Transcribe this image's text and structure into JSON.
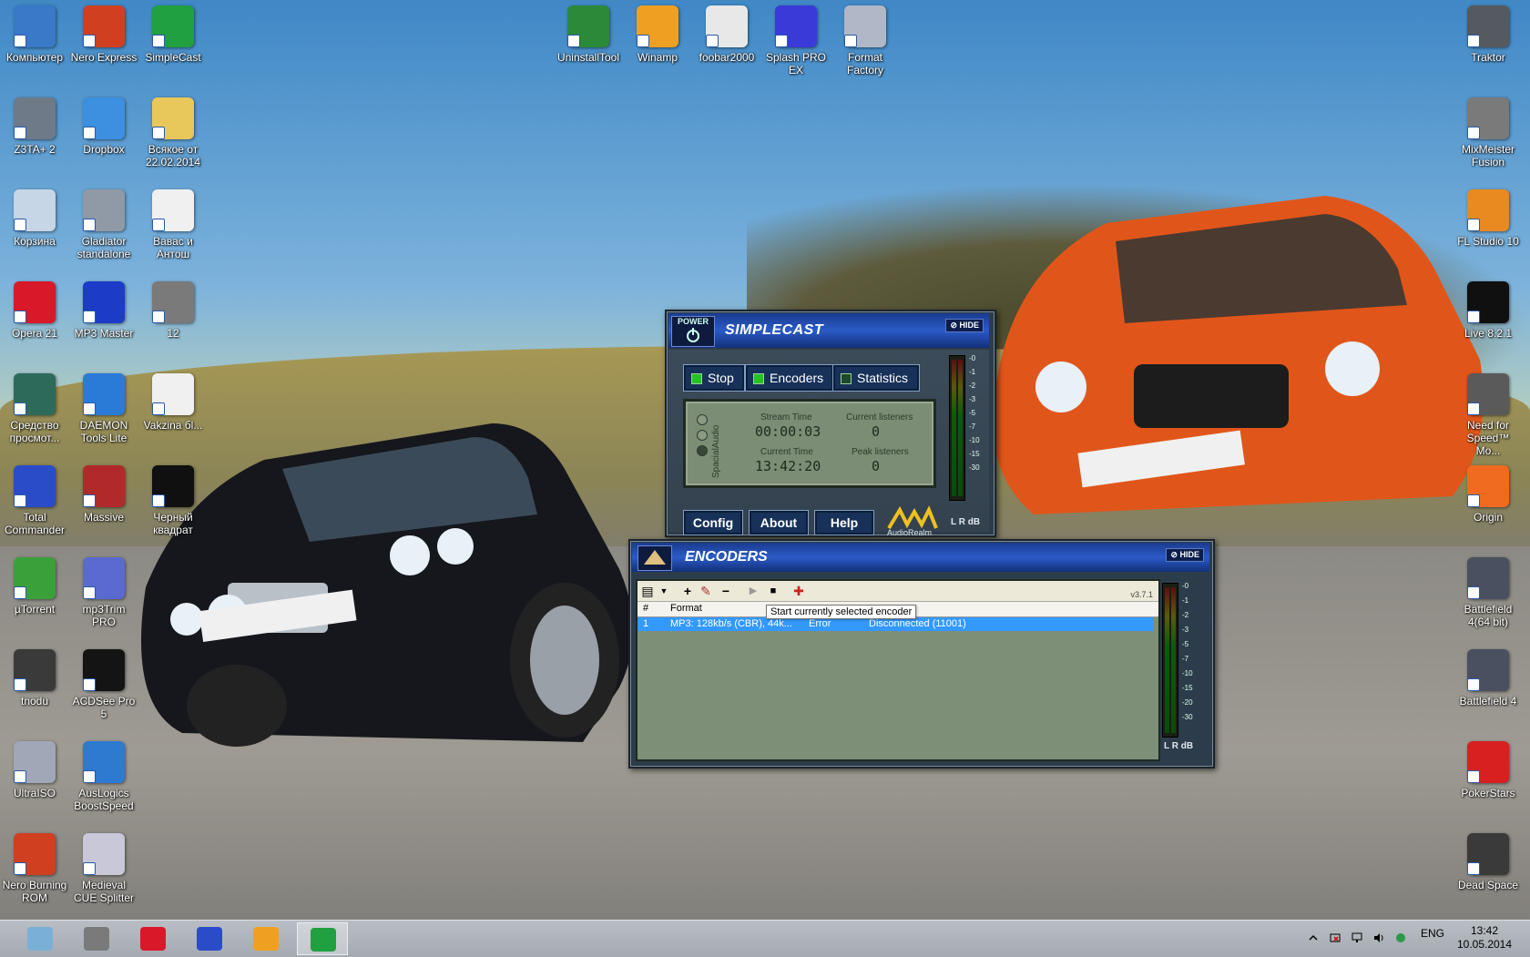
{
  "desktop": {
    "icons": [
      {
        "label": "Компьютер",
        "icon": "computer-icon",
        "color": "#3a78c8"
      },
      {
        "label": "Nero Express",
        "icon": "nero-flame-icon",
        "color": "#d04020"
      },
      {
        "label": "SimpleCast",
        "icon": "simplecast-icon",
        "color": "#20a040"
      },
      {
        "label": "Z3TA+ 2",
        "icon": "z3ta-icon",
        "color": "#6e7a88"
      },
      {
        "label": "Dropbox",
        "icon": "dropbox-icon",
        "color": "#3d8fe0"
      },
      {
        "label": "Всякое от 22.02.2014",
        "icon": "folder-icon",
        "color": "#e8c85a"
      },
      {
        "label": "Корзина",
        "icon": "recycle-bin-icon",
        "color": "#c6d6e6"
      },
      {
        "label": "Gladiator standalone",
        "icon": "gladiator-icon",
        "color": "#8f9aa6"
      },
      {
        "label": "Вавас и Антош",
        "icon": "document-icon",
        "color": "#f0f0f0"
      },
      {
        "label": "Opera 21",
        "icon": "opera-icon",
        "color": "#d8192a"
      },
      {
        "label": "MP3 Master",
        "icon": "mp3-master-icon",
        "color": "#1c3cc8"
      },
      {
        "label": "12",
        "icon": "mixmeister-icon",
        "color": "#7a7a7a"
      },
      {
        "label": "Средство просмот...",
        "icon": "viewer-icon",
        "color": "#2e6a5a"
      },
      {
        "label": "DAEMON Tools Lite",
        "icon": "daemon-tools-icon",
        "color": "#2a7bd8"
      },
      {
        "label": "Vakzina бl...",
        "icon": "document-icon",
        "color": "#f0f0f0"
      },
      {
        "label": "Total Commander",
        "icon": "floppy-icon",
        "color": "#2a4cc8"
      },
      {
        "label": "Massive",
        "icon": "massive-icon",
        "color": "#b02a2a"
      },
      {
        "label": "Черный квадрат",
        "icon": "black-square-icon",
        "color": "#101010"
      },
      {
        "label": "µTorrent",
        "icon": "utorrent-icon",
        "color": "#3aa13a"
      },
      {
        "label": "mp3Trim PRO",
        "icon": "mp3trim-icon",
        "color": "#5a6ad0"
      },
      {
        "label": "tnodu",
        "icon": "skull-icon",
        "color": "#3a3a3a"
      },
      {
        "label": "ACDSee Pro 5",
        "icon": "acdsee-icon",
        "color": "#141414"
      },
      {
        "label": "UltraISO",
        "icon": "cd-icon",
        "color": "#a0a8b8"
      },
      {
        "label": "AusLogics BoostSpeed",
        "icon": "globe-icon",
        "color": "#2e7ad0"
      },
      {
        "label": "Nero Burning ROM",
        "icon": "nero-flame-icon",
        "color": "#d04020"
      },
      {
        "label": "Medieval CUE Splitter",
        "icon": "cue-icon",
        "color": "#c8c8d8"
      },
      {
        "label": "UninstallTool",
        "icon": "uninstall-icon",
        "color": "#2a8a3a"
      },
      {
        "label": "Winamp",
        "icon": "winamp-icon",
        "color": "#f0a020"
      },
      {
        "label": "foobar2000",
        "icon": "foobar-icon",
        "color": "#e8e8e8"
      },
      {
        "label": "Splash PRO EX",
        "icon": "splash-icon",
        "color": "#3a3ad8"
      },
      {
        "label": "Format Factory",
        "icon": "format-factory-icon",
        "color": "#b0b8c8"
      },
      {
        "label": "Traktor",
        "icon": "traktor-icon",
        "color": "#555a60"
      },
      {
        "label": "MixMeister Fusion",
        "icon": "mixmeister-icon",
        "color": "#7a7a7a"
      },
      {
        "label": "FL Studio 10",
        "icon": "fl-studio-icon",
        "color": "#e88a20"
      },
      {
        "label": "Live 8.2.1",
        "icon": "ableton-icon",
        "color": "#101010"
      },
      {
        "label": "Need for Speed™ Mo...",
        "icon": "nfs-icon",
        "color": "#5a5a5a"
      },
      {
        "label": "Origin",
        "icon": "origin-icon",
        "color": "#f06a20"
      },
      {
        "label": "Battlefield 4(64 bit)",
        "icon": "battlefield-icon",
        "color": "#4a5060"
      },
      {
        "label": "Battlefield 4",
        "icon": "battlefield-icon",
        "color": "#4a5060"
      },
      {
        "label": "PokerStars",
        "icon": "pokerstars-icon",
        "color": "#d82020"
      },
      {
        "label": "Dead Space",
        "icon": "dead-space-icon",
        "color": "#3a3a3a"
      }
    ]
  },
  "simplecast": {
    "brand": "SIMPLECAST",
    "power_label": "POWER",
    "hide_label": "HIDE",
    "buttons": {
      "stop": "Stop",
      "encoders": "Encoders",
      "statistics": "Statistics"
    },
    "stream_time_label": "Stream Time",
    "stream_time": "00:00:03",
    "current_time_label": "Current Time",
    "current_time": "13:42:20",
    "current_listeners_label": "Current listeners",
    "current_listeners": "0",
    "peak_listeners_label": "Peak listeners",
    "peak_listeners": "0",
    "side_label": "SpacialAudio",
    "config": "Config",
    "about": "About",
    "help": "Help",
    "logo_text": "AudioRealm",
    "vu_scale": [
      "-0",
      "-1",
      "-2",
      "-3",
      "-5",
      "-7",
      "-10",
      "-15",
      "-30"
    ],
    "vu_footer": "L R dB"
  },
  "encoders": {
    "brand": "ENCODERS",
    "hide_label": "HIDE",
    "version": "v3.7.1",
    "columns": [
      "#",
      "Format",
      "",
      ""
    ],
    "rows": [
      {
        "num": "1",
        "format": "MP3: 128kb/s (CBR), 44k...",
        "state": "Error",
        "status": "Disconnected (11001)"
      }
    ],
    "tooltip": "Start currently selected encoder",
    "vu_scale": [
      "-0",
      "-1",
      "-2",
      "-3",
      "-5",
      "-7",
      "-10",
      "-15",
      "-20",
      "-30"
    ],
    "vu_footer": "L R dB"
  },
  "taskbar": {
    "tray_lang": "ENG",
    "time": "13:42",
    "date": "10.05.2014",
    "tasks": [
      {
        "icon": "explorer-icon",
        "color": "#7ab0d8"
      },
      {
        "icon": "mixmeister-icon",
        "color": "#7a7a7a"
      },
      {
        "icon": "opera-icon",
        "color": "#d8192a"
      },
      {
        "icon": "floppy-icon",
        "color": "#2a4cc8"
      },
      {
        "icon": "winamp-icon",
        "color": "#f0a020"
      },
      {
        "icon": "simplecast-icon",
        "color": "#20a040"
      }
    ]
  }
}
